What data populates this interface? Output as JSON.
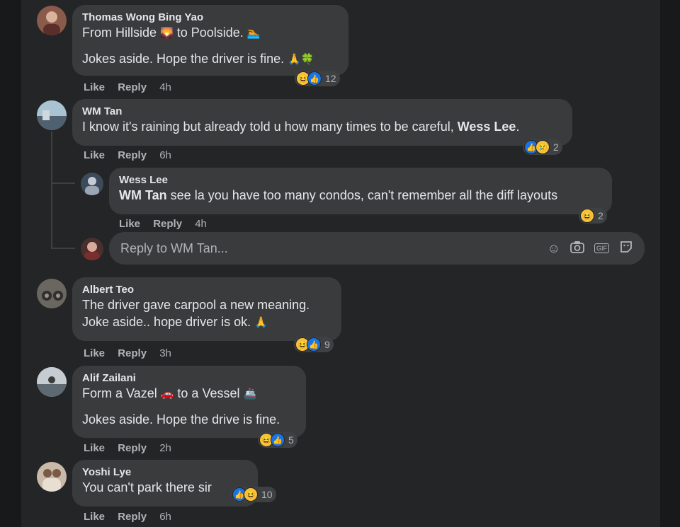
{
  "comments": [
    {
      "author": "Thomas Wong Bing Yao",
      "line1_a": "From Hillside",
      "line1_b": "to Poolside.",
      "line2": "Jokes aside. Hope the driver is fine.",
      "actions": {
        "like": "Like",
        "reply": "Reply",
        "time": "4h"
      },
      "reactions": {
        "icons": [
          "haha-icon",
          "like-icon"
        ],
        "count": "12"
      }
    },
    {
      "author": "WM Tan",
      "line1": "I know it's raining but already told u how many times to be careful,",
      "mention": "Wess Lee",
      "line1_end": ".",
      "actions": {
        "like": "Like",
        "reply": "Reply",
        "time": "6h"
      },
      "reactions": {
        "icons": [
          "like-icon",
          "sad-icon"
        ],
        "count": "2"
      }
    },
    {
      "author": "Wess Lee",
      "mention": "WM Tan",
      "line1": "see la you have too many condos, can't remember all the diff layouts",
      "actions": {
        "like": "Like",
        "reply": "Reply",
        "time": "4h"
      },
      "reactions": {
        "icons": [
          "haha-icon"
        ],
        "count": "2"
      }
    },
    {
      "author": "Albert Teo",
      "line1": "The driver gave carpool a new meaning.",
      "line2": "Joke aside.. hope driver is ok.",
      "actions": {
        "like": "Like",
        "reply": "Reply",
        "time": "3h"
      },
      "reactions": {
        "icons": [
          "haha-icon",
          "like-icon"
        ],
        "count": "9"
      }
    },
    {
      "author": "Alif Zailani",
      "line1_a": "Form a Vazel",
      "line1_b": "to a Vessel",
      "line2": "Jokes aside. Hope the drive is fine.",
      "actions": {
        "like": "Like",
        "reply": "Reply",
        "time": "2h"
      },
      "reactions": {
        "icons": [
          "haha-icon",
          "like-icon"
        ],
        "count": "5"
      }
    },
    {
      "author": "Yoshi Lye",
      "line1": "You can't park there sir",
      "actions": {
        "like": "Like",
        "reply": "Reply",
        "time": "6h"
      },
      "reactions": {
        "icons": [
          "like-icon",
          "haha-icon"
        ],
        "count": "10"
      }
    }
  ],
  "reply_box": {
    "placeholder": "Reply to WM Tan...",
    "tools": [
      "smiley-icon",
      "camera-icon",
      "gif-icon",
      "sticker-icon"
    ],
    "gif_label": "GIF"
  },
  "colors": {
    "panel": "#242526",
    "bubble": "#3a3b3c",
    "text": "#e4e6eb",
    "muted": "#b0b3b8",
    "like_blue": "#1b74e4",
    "haha_yellow": "#f7c33b"
  }
}
